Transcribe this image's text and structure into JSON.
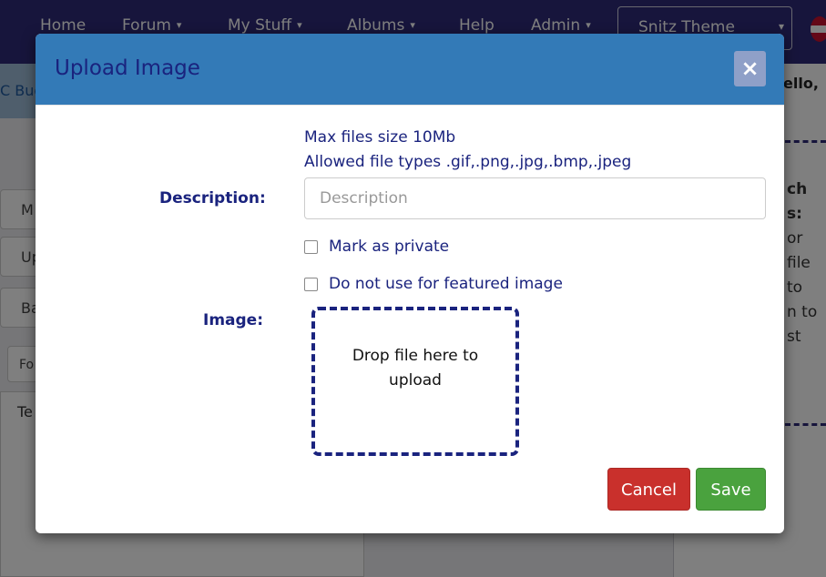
{
  "navbar": {
    "items": [
      {
        "label": "Home",
        "has_caret": false
      },
      {
        "label": "Forum",
        "has_caret": true
      },
      {
        "label": "My Stuff",
        "has_caret": true
      },
      {
        "label": "Albums",
        "has_caret": true
      },
      {
        "label": "Help",
        "has_caret": false
      },
      {
        "label": "Admin",
        "has_caret": true
      }
    ],
    "caret": "▾",
    "theme_select": {
      "value": "Snitz Theme",
      "caret": "▾"
    },
    "flag_icon": "uk-flag-icon"
  },
  "background": {
    "breadcrumb_text": "C Bug",
    "hello_text": "ello,",
    "left_buttons": [
      "M",
      "Up",
      "Ba",
      "Fo"
    ],
    "editor_text": "Te",
    "right_text_lines": [
      "ch",
      "s:",
      "or",
      "file",
      "to",
      "n to",
      "st"
    ]
  },
  "modal": {
    "title": "Upload Image",
    "close_label": "×",
    "max_size_text": "Max files size 10Mb",
    "allowed_types_text": "Allowed file types .gif,.png,.jpg,.bmp,.jpeg",
    "description_label": "Description:",
    "description_placeholder": "Description",
    "description_value": "",
    "private_label": "Mark as private",
    "private_checked": false,
    "featured_label": "Do not use for featured image",
    "featured_checked": false,
    "image_label": "Image:",
    "dropzone_text": "Drop file here to upload",
    "cancel_label": "Cancel",
    "save_label": "Save"
  },
  "colors": {
    "header_bg": "#337ab7",
    "title_text": "#1a237e",
    "cancel_bg": "#c9302c",
    "save_bg": "#4aa23e",
    "navbar_bg": "#2e2a78"
  }
}
